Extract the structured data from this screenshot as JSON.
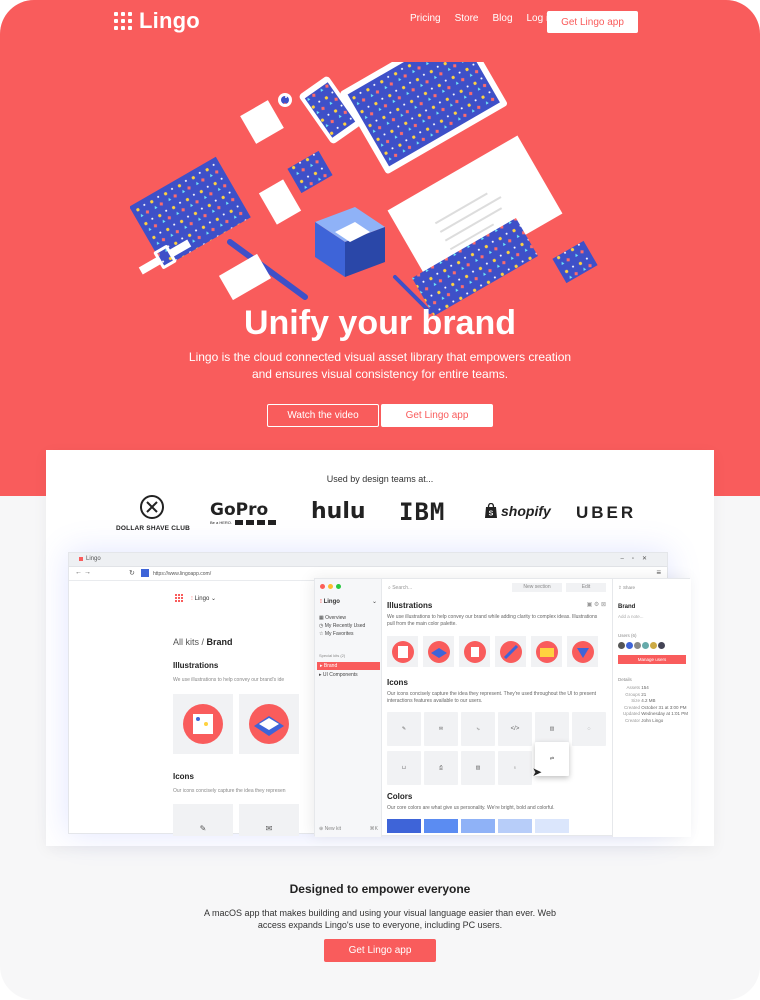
{
  "nav": {
    "logo_text": "Lingo",
    "links": [
      "Pricing",
      "Store",
      "Blog",
      "Log in"
    ],
    "cta": "Get Lingo app"
  },
  "hero": {
    "title": "Unify your brand",
    "subtitle": "Lingo is the cloud connected visual asset library that empowers creation and ensures visual consistency for entire teams.",
    "watch_video": "Watch the video",
    "cta": "Get Lingo app"
  },
  "brands": {
    "heading": "Used by design teams at...",
    "dollar_shave_club": "DOLLAR SHAVE CLUB",
    "gopro": "GoPro",
    "gopro_tag": "Be a HERO.",
    "hulu": "hulu",
    "ibm": "IBM",
    "shopify": "shopify",
    "uber": "UBER"
  },
  "mockup": {
    "browser": {
      "tab_title": "Lingo",
      "url": "https://www.lingoapp.com/",
      "kit_name": "Lingo",
      "breadcrumb_prefix": "All kits /",
      "breadcrumb_current": "Brand",
      "illustrations_heading": "Illustrations",
      "illustrations_desc": "We use illustrations to help convey our brand's ide",
      "icons_heading": "Icons",
      "icons_desc": "Our icons concisely capture the idea they represen"
    },
    "app": {
      "kit_name": "Lingo",
      "nav": [
        "Overview",
        "My Recently Used",
        "My Favorites"
      ],
      "section_label": "Special kits (2)",
      "kits": [
        "Brand",
        "UI Components"
      ],
      "new_kit": "New kit",
      "new_kit_shortcut": "⌘K",
      "search_placeholder": "Search...",
      "new_section": "New section",
      "edit": "Edit",
      "illustrations_heading": "Illustrations",
      "illustrations_desc": "We use illustrations to help convey our brand while adding clarity to complex ideas. Illustrations pull from the main color palette.",
      "icons_heading": "Icons",
      "icons_desc": "Our icons concisely capture the idea they represent. They're used throughout the UI to present interactions features available to our users.",
      "colors_heading": "Colors",
      "colors_desc": "Our core colors are what give us personality. We're bright, bold and colorful.",
      "colors": [
        "#3e64d8",
        "#5b8cf2",
        "#8fb2f7",
        "#b7cdf9",
        "#dbe6fc"
      ],
      "share": "Share",
      "inspector_title": "Brand",
      "add_note": "Add a note...",
      "users_label": "Users (6)",
      "manage_users": "Manage users",
      "details_label": "Details",
      "details": [
        {
          "k": "Assets",
          "v": "154"
        },
        {
          "k": "Groups",
          "v": "21"
        },
        {
          "k": "Size",
          "v": "4.2 MB"
        },
        {
          "k": "Created",
          "v": "October 31 at 3:00 PM"
        },
        {
          "k": "Updated",
          "v": "Wednesday at 1:01 PM"
        },
        {
          "k": "Creator",
          "v": "John Lingo"
        }
      ]
    }
  },
  "bottom": {
    "title": "Designed to empower everyone",
    "subtitle": "A macOS app that makes building and using your visual language easier than ever. Web access expands Lingo's use to everyone, including PC users.",
    "cta": "Get Lingo app"
  },
  "colors": {
    "brand_red": "#f95c5c",
    "pattern_blue": "#3e50c8"
  }
}
